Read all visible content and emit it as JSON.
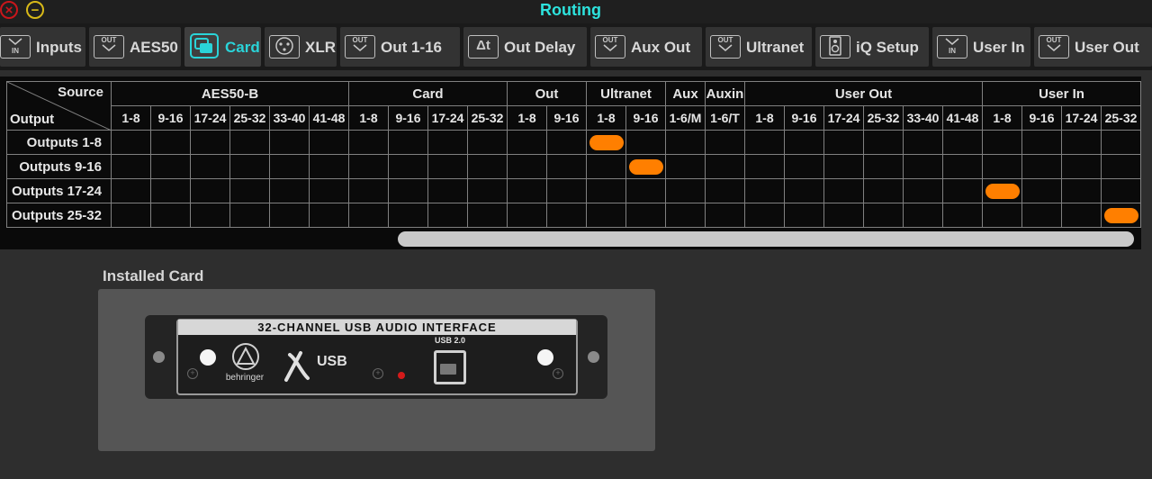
{
  "window": {
    "title": "Routing",
    "close_glyph": "×",
    "minimize_glyph": "−"
  },
  "tabs": [
    {
      "label": "Inputs",
      "icon": "in-icon",
      "icon_text": "IN"
    },
    {
      "label": "AES50",
      "icon": "out-icon",
      "icon_text": "OUT"
    },
    {
      "label": "Card",
      "icon": "card-icon",
      "icon_text": "",
      "active": true
    },
    {
      "label": "XLR",
      "icon": "xlr-icon",
      "icon_text": ""
    },
    {
      "label": "Out 1-16",
      "icon": "out-icon",
      "icon_text": "OUT"
    },
    {
      "label": "Out Delay",
      "icon": "delta-t-icon",
      "icon_text": "Δt"
    },
    {
      "label": "Aux Out",
      "icon": "out-icon",
      "icon_text": "OUT"
    },
    {
      "label": "Ultranet",
      "icon": "out-icon",
      "icon_text": "OUT"
    },
    {
      "label": "iQ Setup",
      "icon": "speaker-icon",
      "icon_text": ""
    },
    {
      "label": "User In",
      "icon": "in-icon",
      "icon_text": "IN"
    },
    {
      "label": "User Out",
      "icon": "out-icon",
      "icon_text": "OUT"
    }
  ],
  "matrix": {
    "corner_source": "Source",
    "corner_output": "Output",
    "groups": [
      {
        "label": "AES50-B",
        "columns": [
          "1-8",
          "9-16",
          "17-24",
          "25-32",
          "33-40",
          "41-48"
        ]
      },
      {
        "label": "Card",
        "columns": [
          "1-8",
          "9-16",
          "17-24",
          "25-32"
        ]
      },
      {
        "label": "Out",
        "columns": [
          "1-8",
          "9-16"
        ]
      },
      {
        "label": "Ultranet",
        "columns": [
          "1-8",
          "9-16"
        ]
      },
      {
        "label": "Aux",
        "columns": [
          "1-6/M"
        ]
      },
      {
        "label": "Auxin",
        "columns": [
          "1-6/T"
        ]
      },
      {
        "label": "User Out",
        "columns": [
          "1-8",
          "9-16",
          "17-24",
          "25-32",
          "33-40",
          "41-48"
        ]
      },
      {
        "label": "User In",
        "columns": [
          "1-8",
          "9-16",
          "17-24",
          "25-32"
        ]
      }
    ],
    "rows": [
      "Outputs 1-8",
      "Outputs 9-16",
      "Outputs 17-24",
      "Outputs 25-32"
    ],
    "routes": [
      {
        "row": 0,
        "source": "Ultranet 1-8"
      },
      {
        "row": 1,
        "source": "Ultranet 9-16"
      },
      {
        "row": 2,
        "source": "User In 1-8"
      },
      {
        "row": 3,
        "source": "User In 25-32"
      }
    ],
    "active_color": "#ff7f00"
  },
  "installed_card": {
    "label": "Installed Card",
    "card_title": "32-CHANNEL USB AUDIO INTERFACE",
    "usb_label": "USB 2.0",
    "brand": "behringer",
    "logo_text": "X USB"
  },
  "colors": {
    "accent": "#2de3de",
    "active_route": "#ff7f00",
    "close": "#c9161b",
    "minimize": "#d8b918"
  }
}
